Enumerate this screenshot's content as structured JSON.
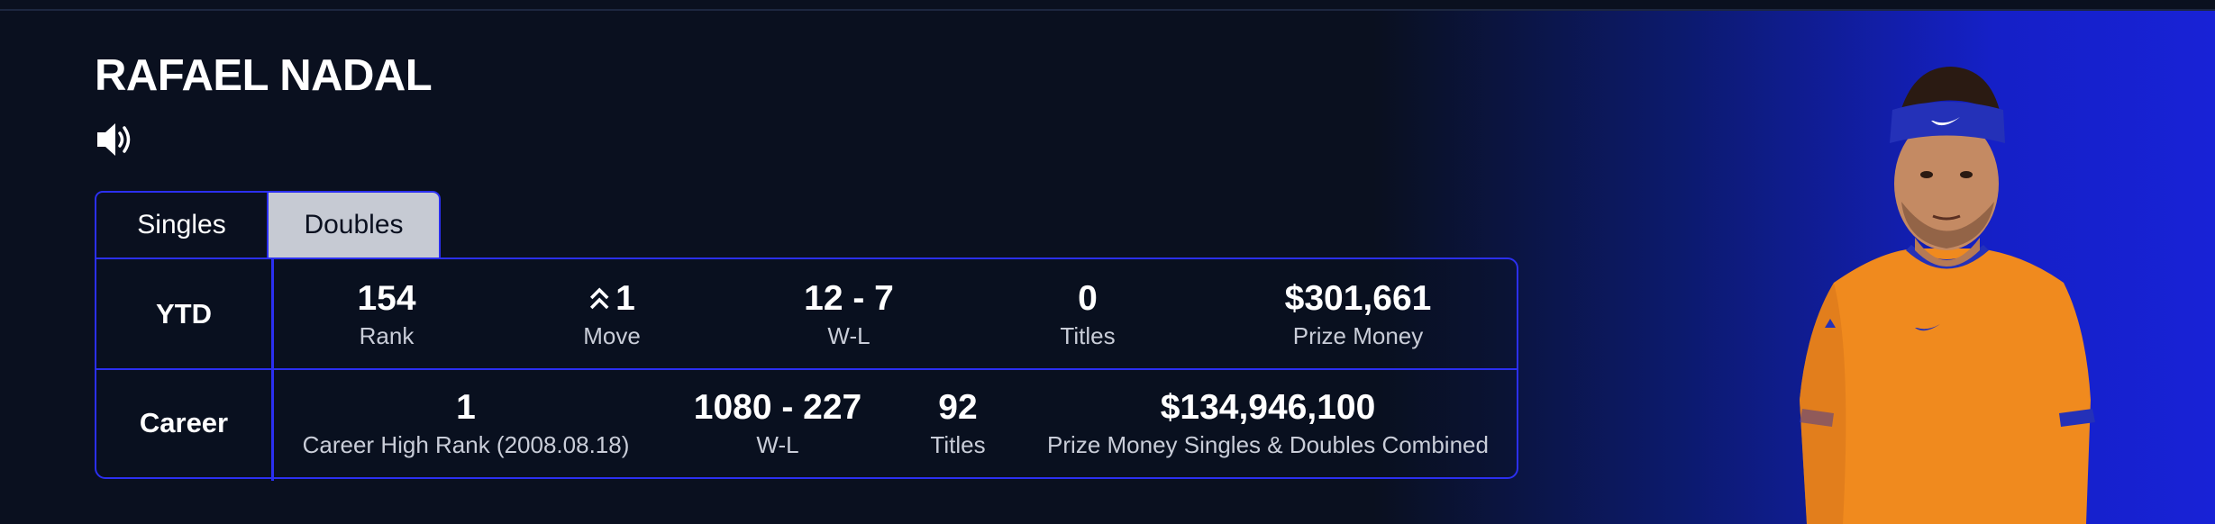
{
  "player": {
    "name": "RAFAEL NADAL"
  },
  "icons": {
    "audio": "speaker-icon",
    "move": "double-chevron-up-icon"
  },
  "tabs": [
    {
      "label": "Singles",
      "active": false
    },
    {
      "label": "Doubles",
      "active": true
    }
  ],
  "ytd": {
    "label": "YTD",
    "stats": [
      {
        "value": "154",
        "label": "Rank"
      },
      {
        "value": "1",
        "label": "Move"
      },
      {
        "value": "12 - 7",
        "label": "W-L"
      },
      {
        "value": "0",
        "label": "Titles"
      },
      {
        "value": "$301,661",
        "label": "Prize Money"
      }
    ]
  },
  "career": {
    "label": "Career",
    "stats": [
      {
        "value": "1",
        "label": "Career High Rank (2008.08.18)"
      },
      {
        "value": "1080 - 227",
        "label": "W-L"
      },
      {
        "value": "92",
        "label": "Titles"
      },
      {
        "value": "$134,946,100",
        "label": "Prize Money Singles & Doubles Combined"
      }
    ]
  },
  "colors": {
    "background": "#0a101f",
    "accent_border": "#2b2ff0",
    "active_tab": "#c6cad3",
    "glow": "#1822d6",
    "shirt": "#f08a1e"
  }
}
